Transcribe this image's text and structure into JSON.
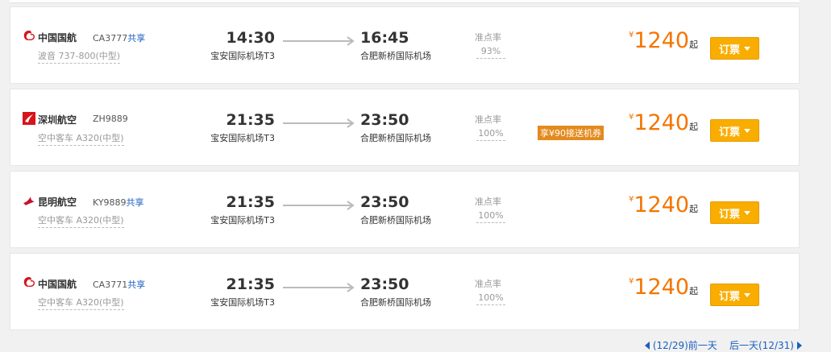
{
  "flights": [
    {
      "airline": "中国国航",
      "logo": "air-china-logo",
      "flight_no": "CA3777",
      "share": "共享",
      "aircraft": "波音 737-800(中型)",
      "dep_time": "14:30",
      "dep_airport": "宝安国际机场T3",
      "arr_time": "16:45",
      "arr_airport": "合肥新桥国际机场",
      "ontime_label": "准点率",
      "ontime": "93%",
      "promo": "",
      "currency": "¥",
      "price": "1240",
      "price_suffix": "起",
      "book_label": "订票"
    },
    {
      "airline": "深圳航空",
      "logo": "shenzhen-airlines-logo",
      "flight_no": "ZH9889",
      "share": "",
      "aircraft": "空中客车 A320(中型)",
      "dep_time": "21:35",
      "dep_airport": "宝安国际机场T3",
      "arr_time": "23:50",
      "arr_airport": "合肥新桥国际机场",
      "ontime_label": "准点率",
      "ontime": "100%",
      "promo": "享¥90接送机券",
      "currency": "¥",
      "price": "1240",
      "price_suffix": "起",
      "book_label": "订票"
    },
    {
      "airline": "昆明航空",
      "logo": "kunming-airlines-logo",
      "flight_no": "KY9889",
      "share": "共享",
      "aircraft": "空中客车 A320(中型)",
      "dep_time": "21:35",
      "dep_airport": "宝安国际机场T3",
      "arr_time": "23:50",
      "arr_airport": "合肥新桥国际机场",
      "ontime_label": "准点率",
      "ontime": "100%",
      "promo": "",
      "currency": "¥",
      "price": "1240",
      "price_suffix": "起",
      "book_label": "订票"
    },
    {
      "airline": "中国国航",
      "logo": "air-china-logo",
      "flight_no": "CA3771",
      "share": "共享",
      "aircraft": "空中客车 A320(中型)",
      "dep_time": "21:35",
      "dep_airport": "宝安国际机场T3",
      "arr_time": "23:50",
      "arr_airport": "合肥新桥国际机场",
      "ontime_label": "准点率",
      "ontime": "100%",
      "promo": "",
      "currency": "¥",
      "price": "1240",
      "price_suffix": "起",
      "book_label": "订票"
    }
  ],
  "pager": {
    "prev_label": "(12/29)前一天",
    "next_label": "后一天(12/31)"
  },
  "colors": {
    "price": "#f47500",
    "book_button": "#f9ad00",
    "share_link": "#1b5fbf",
    "promo_bg": "#e38a1e"
  }
}
